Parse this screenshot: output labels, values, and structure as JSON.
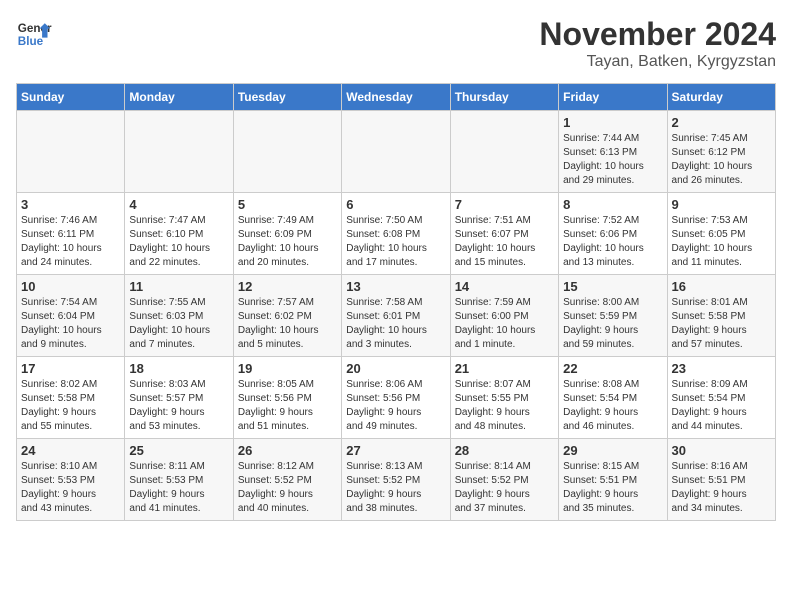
{
  "header": {
    "logo_line1": "General",
    "logo_line2": "Blue",
    "month_year": "November 2024",
    "location": "Tayan, Batken, Kyrgyzstan"
  },
  "weekdays": [
    "Sunday",
    "Monday",
    "Tuesday",
    "Wednesday",
    "Thursday",
    "Friday",
    "Saturday"
  ],
  "weeks": [
    [
      {
        "day": "",
        "info": ""
      },
      {
        "day": "",
        "info": ""
      },
      {
        "day": "",
        "info": ""
      },
      {
        "day": "",
        "info": ""
      },
      {
        "day": "",
        "info": ""
      },
      {
        "day": "1",
        "info": "Sunrise: 7:44 AM\nSunset: 6:13 PM\nDaylight: 10 hours\nand 29 minutes."
      },
      {
        "day": "2",
        "info": "Sunrise: 7:45 AM\nSunset: 6:12 PM\nDaylight: 10 hours\nand 26 minutes."
      }
    ],
    [
      {
        "day": "3",
        "info": "Sunrise: 7:46 AM\nSunset: 6:11 PM\nDaylight: 10 hours\nand 24 minutes."
      },
      {
        "day": "4",
        "info": "Sunrise: 7:47 AM\nSunset: 6:10 PM\nDaylight: 10 hours\nand 22 minutes."
      },
      {
        "day": "5",
        "info": "Sunrise: 7:49 AM\nSunset: 6:09 PM\nDaylight: 10 hours\nand 20 minutes."
      },
      {
        "day": "6",
        "info": "Sunrise: 7:50 AM\nSunset: 6:08 PM\nDaylight: 10 hours\nand 17 minutes."
      },
      {
        "day": "7",
        "info": "Sunrise: 7:51 AM\nSunset: 6:07 PM\nDaylight: 10 hours\nand 15 minutes."
      },
      {
        "day": "8",
        "info": "Sunrise: 7:52 AM\nSunset: 6:06 PM\nDaylight: 10 hours\nand 13 minutes."
      },
      {
        "day": "9",
        "info": "Sunrise: 7:53 AM\nSunset: 6:05 PM\nDaylight: 10 hours\nand 11 minutes."
      }
    ],
    [
      {
        "day": "10",
        "info": "Sunrise: 7:54 AM\nSunset: 6:04 PM\nDaylight: 10 hours\nand 9 minutes."
      },
      {
        "day": "11",
        "info": "Sunrise: 7:55 AM\nSunset: 6:03 PM\nDaylight: 10 hours\nand 7 minutes."
      },
      {
        "day": "12",
        "info": "Sunrise: 7:57 AM\nSunset: 6:02 PM\nDaylight: 10 hours\nand 5 minutes."
      },
      {
        "day": "13",
        "info": "Sunrise: 7:58 AM\nSunset: 6:01 PM\nDaylight: 10 hours\nand 3 minutes."
      },
      {
        "day": "14",
        "info": "Sunrise: 7:59 AM\nSunset: 6:00 PM\nDaylight: 10 hours\nand 1 minute."
      },
      {
        "day": "15",
        "info": "Sunrise: 8:00 AM\nSunset: 5:59 PM\nDaylight: 9 hours\nand 59 minutes."
      },
      {
        "day": "16",
        "info": "Sunrise: 8:01 AM\nSunset: 5:58 PM\nDaylight: 9 hours\nand 57 minutes."
      }
    ],
    [
      {
        "day": "17",
        "info": "Sunrise: 8:02 AM\nSunset: 5:58 PM\nDaylight: 9 hours\nand 55 minutes."
      },
      {
        "day": "18",
        "info": "Sunrise: 8:03 AM\nSunset: 5:57 PM\nDaylight: 9 hours\nand 53 minutes."
      },
      {
        "day": "19",
        "info": "Sunrise: 8:05 AM\nSunset: 5:56 PM\nDaylight: 9 hours\nand 51 minutes."
      },
      {
        "day": "20",
        "info": "Sunrise: 8:06 AM\nSunset: 5:56 PM\nDaylight: 9 hours\nand 49 minutes."
      },
      {
        "day": "21",
        "info": "Sunrise: 8:07 AM\nSunset: 5:55 PM\nDaylight: 9 hours\nand 48 minutes."
      },
      {
        "day": "22",
        "info": "Sunrise: 8:08 AM\nSunset: 5:54 PM\nDaylight: 9 hours\nand 46 minutes."
      },
      {
        "day": "23",
        "info": "Sunrise: 8:09 AM\nSunset: 5:54 PM\nDaylight: 9 hours\nand 44 minutes."
      }
    ],
    [
      {
        "day": "24",
        "info": "Sunrise: 8:10 AM\nSunset: 5:53 PM\nDaylight: 9 hours\nand 43 minutes."
      },
      {
        "day": "25",
        "info": "Sunrise: 8:11 AM\nSunset: 5:53 PM\nDaylight: 9 hours\nand 41 minutes."
      },
      {
        "day": "26",
        "info": "Sunrise: 8:12 AM\nSunset: 5:52 PM\nDaylight: 9 hours\nand 40 minutes."
      },
      {
        "day": "27",
        "info": "Sunrise: 8:13 AM\nSunset: 5:52 PM\nDaylight: 9 hours\nand 38 minutes."
      },
      {
        "day": "28",
        "info": "Sunrise: 8:14 AM\nSunset: 5:52 PM\nDaylight: 9 hours\nand 37 minutes."
      },
      {
        "day": "29",
        "info": "Sunrise: 8:15 AM\nSunset: 5:51 PM\nDaylight: 9 hours\nand 35 minutes."
      },
      {
        "day": "30",
        "info": "Sunrise: 8:16 AM\nSunset: 5:51 PM\nDaylight: 9 hours\nand 34 minutes."
      }
    ]
  ]
}
